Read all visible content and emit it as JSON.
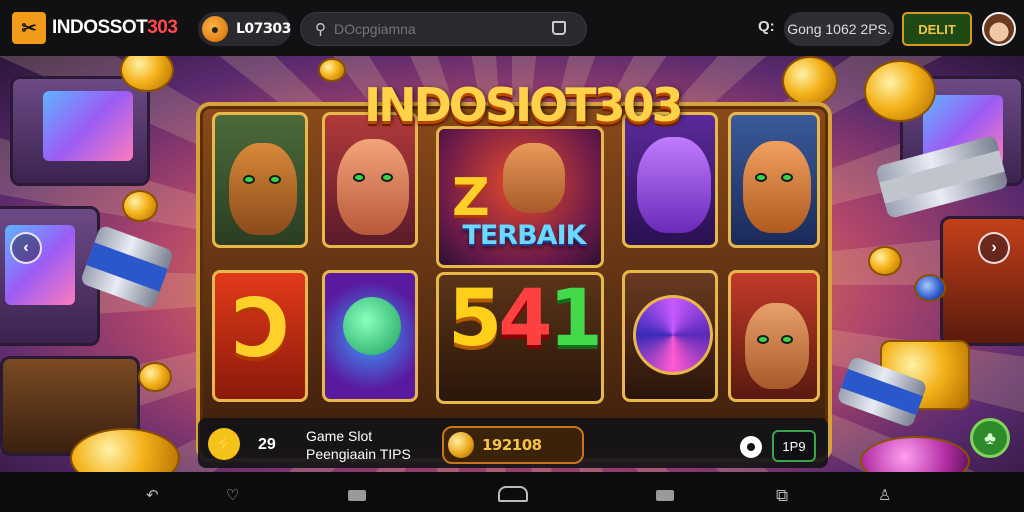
{
  "topbar": {
    "brand_main": "INDOSSOT",
    "brand_accent": "303",
    "logo_glyph": "✂",
    "balance": "L07З03",
    "search_placeholder": "DOcpgiamna",
    "cash": "Gong 1062 2PS.",
    "deposit_label": "DELIT",
    "help_glyph": "Q:"
  },
  "game": {
    "title_art": "INDOSIOT303",
    "terbaik": "TERBAIK",
    "z_symbol": "Z",
    "d_symbol": "Ɔ",
    "num_a": "5",
    "num_b": "4",
    "num_c": "1"
  },
  "infobar": {
    "spin_glyph": "⚡",
    "bet": "29",
    "game_title": "Game Slot",
    "game_subtitle": "Peengiaain TIPS",
    "win": "192108",
    "lines": "1P9"
  },
  "nav": {
    "prev": "‹",
    "next": "›"
  },
  "icons": {
    "back": "back-icon",
    "bookmark": "bookmark-icon",
    "home": "home-icon",
    "tabs": "tabs-icon",
    "account": "account-icon"
  },
  "colors": {
    "accent_orange": "#f29a1a",
    "brand_red": "#ff4a4a",
    "gold": "#ffd24a",
    "deposit_green": "#1f4a16"
  }
}
